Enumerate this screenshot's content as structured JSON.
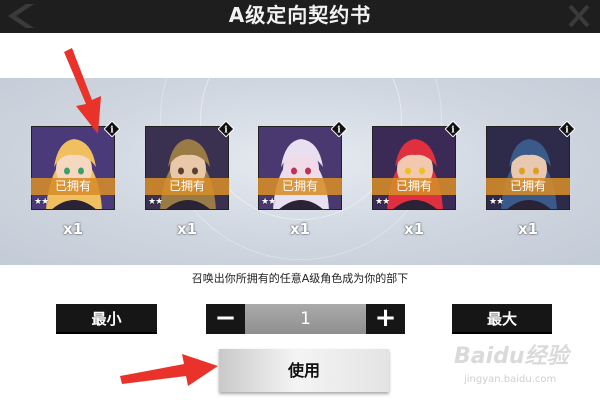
{
  "header": {
    "title": "A级定向契约书",
    "back_icon": "back-icon",
    "close_icon": "close-icon"
  },
  "characters": [
    {
      "owned_label": "已拥有",
      "stars": "★★",
      "count": "x1",
      "hair": "#f0c060",
      "skin": "#f6d8c0",
      "bg": "#4a3a7a",
      "eyes": "#3aa070"
    },
    {
      "owned_label": "已拥有",
      "stars": "★★",
      "count": "x1",
      "hair": "#9a7a45",
      "skin": "#e8c8a8",
      "bg": "#3a3050",
      "eyes": "#5a4030"
    },
    {
      "owned_label": "已拥有",
      "stars": "★★",
      "count": "x1",
      "hair": "#e8e0f0",
      "skin": "#f0dce8",
      "bg": "#4a3870",
      "eyes": "#c03050"
    },
    {
      "owned_label": "已拥有",
      "stars": "★★",
      "count": "x1",
      "hair": "#e03040",
      "skin": "#f2c8b0",
      "bg": "#3a2a55",
      "eyes": "#f0c020"
    },
    {
      "owned_label": "已拥有",
      "stars": "★★",
      "count": "x1",
      "hair": "#3a5a8a",
      "skin": "#e8c8b0",
      "bg": "#2e2a4a",
      "eyes": "#e0a020"
    }
  ],
  "hint": "召唤出你所拥有的任意A级角色成为你的部下",
  "controls": {
    "min_label": "最小",
    "max_label": "最大",
    "minus": "−",
    "plus": "+",
    "quantity": "1",
    "use_label": "使用"
  },
  "watermark": {
    "text": "Baidu经验",
    "sub": "jingyan.baidu.com"
  },
  "colors": {
    "owned_bg": "#d68c28",
    "header_bg": "#1e1e1e",
    "button_bg": "#161616",
    "arrow": "#e8322a"
  }
}
